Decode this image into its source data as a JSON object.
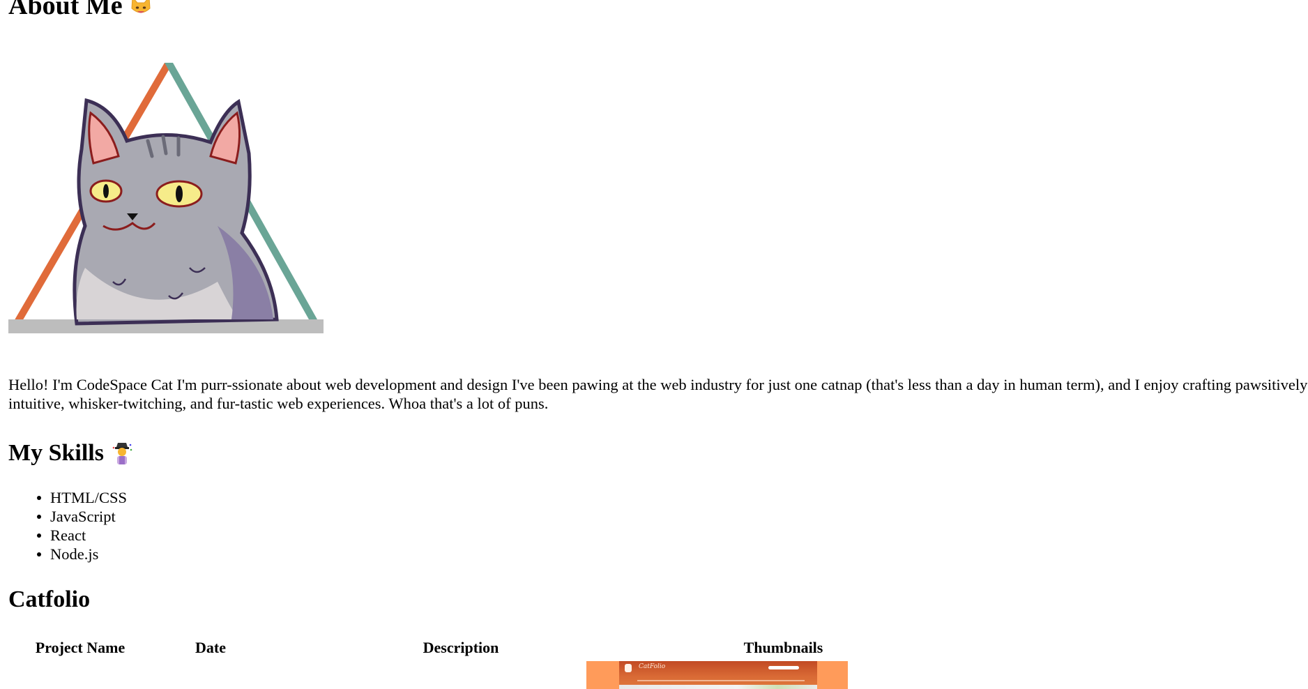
{
  "about": {
    "title": "About Me",
    "title_emoji_icon": "cat-face-icon"
  },
  "intro_text": "Hello! I'm CodeSpace Cat I'm purr-ssionate about web development and design I've been pawing at the web industry for just one catnap (that's less than a day in human term), and I enjoy crafting pawsitively intuitive, whisker-twitching, and fur-tastic web experiences. Whoa that's a lot of puns.",
  "skills": {
    "title": "My Skills",
    "title_emoji_icon": "cat-person-emoji-icon",
    "items": [
      "HTML/CSS",
      "JavaScript",
      "React",
      "Node.js"
    ]
  },
  "catfolio": {
    "title": "Catfolio",
    "columns": [
      "Project Name",
      "Date",
      "Description",
      "Thumbnails"
    ],
    "thumbnail_brand": "CatFolio"
  },
  "colors": {
    "triangle_orange": "#e06b3a",
    "triangle_teal": "#6aa596",
    "thumbnail_bg": "#ff9b5a"
  }
}
